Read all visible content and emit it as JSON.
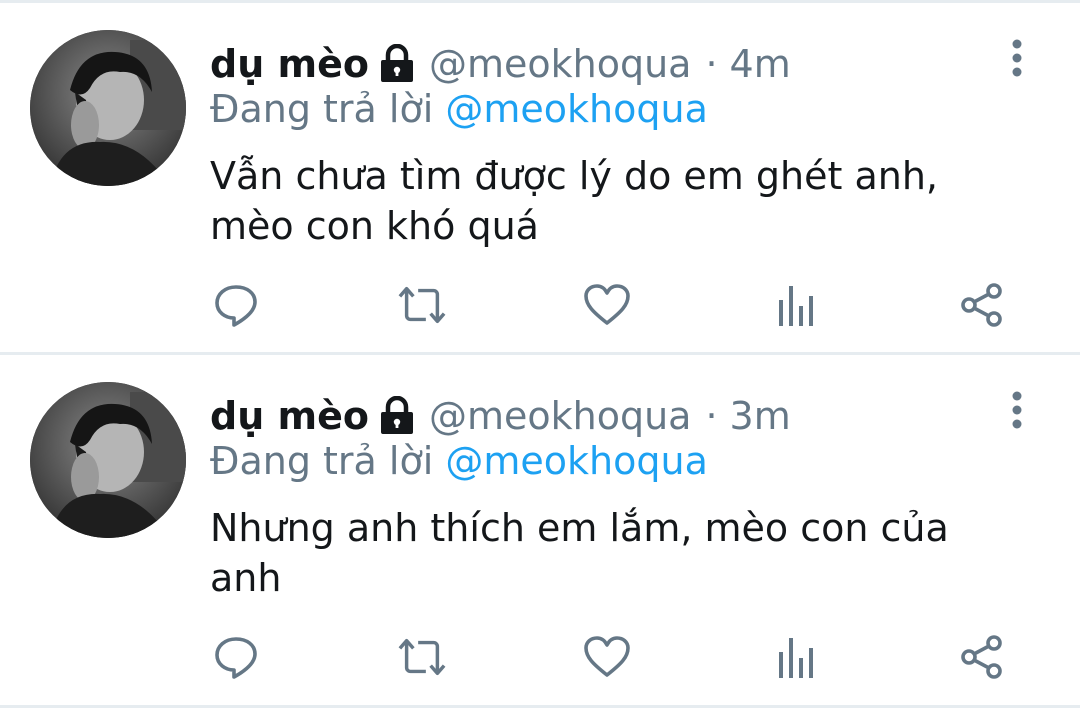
{
  "tweets": [
    {
      "name": "dụ mèo",
      "handle": "@meokhoqua",
      "separator": "·",
      "time": "4m",
      "reply_prefix": "Đang trả lời",
      "reply_to": "@meokhoqua",
      "text_lines": [
        "Vẫn chưa tìm được lý do em ghét anh,",
        "mèo con khó quá"
      ],
      "icons": {
        "lock": "lock-icon",
        "more": "more-vertical-icon",
        "reply": "reply-icon",
        "retweet": "retweet-icon",
        "like": "heart-icon",
        "stats": "analytics-icon",
        "share": "share-icon"
      }
    },
    {
      "name": "dụ mèo",
      "handle": "@meokhoqua",
      "separator": "·",
      "time": "3m",
      "reply_prefix": "Đang trả lời",
      "reply_to": "@meokhoqua",
      "text_lines": [
        "Nhưng anh thích em lắm, mèo con của",
        "anh"
      ],
      "icons": {
        "lock": "lock-icon",
        "more": "more-vertical-icon",
        "reply": "reply-icon",
        "retweet": "retweet-icon",
        "like": "heart-icon",
        "stats": "analytics-icon",
        "share": "share-icon"
      }
    }
  ],
  "colors": {
    "text_primary": "#14171a",
    "text_secondary": "#657786",
    "mention": "#1da1f2",
    "icon": "#657786",
    "divider": "#e6ecf0"
  }
}
